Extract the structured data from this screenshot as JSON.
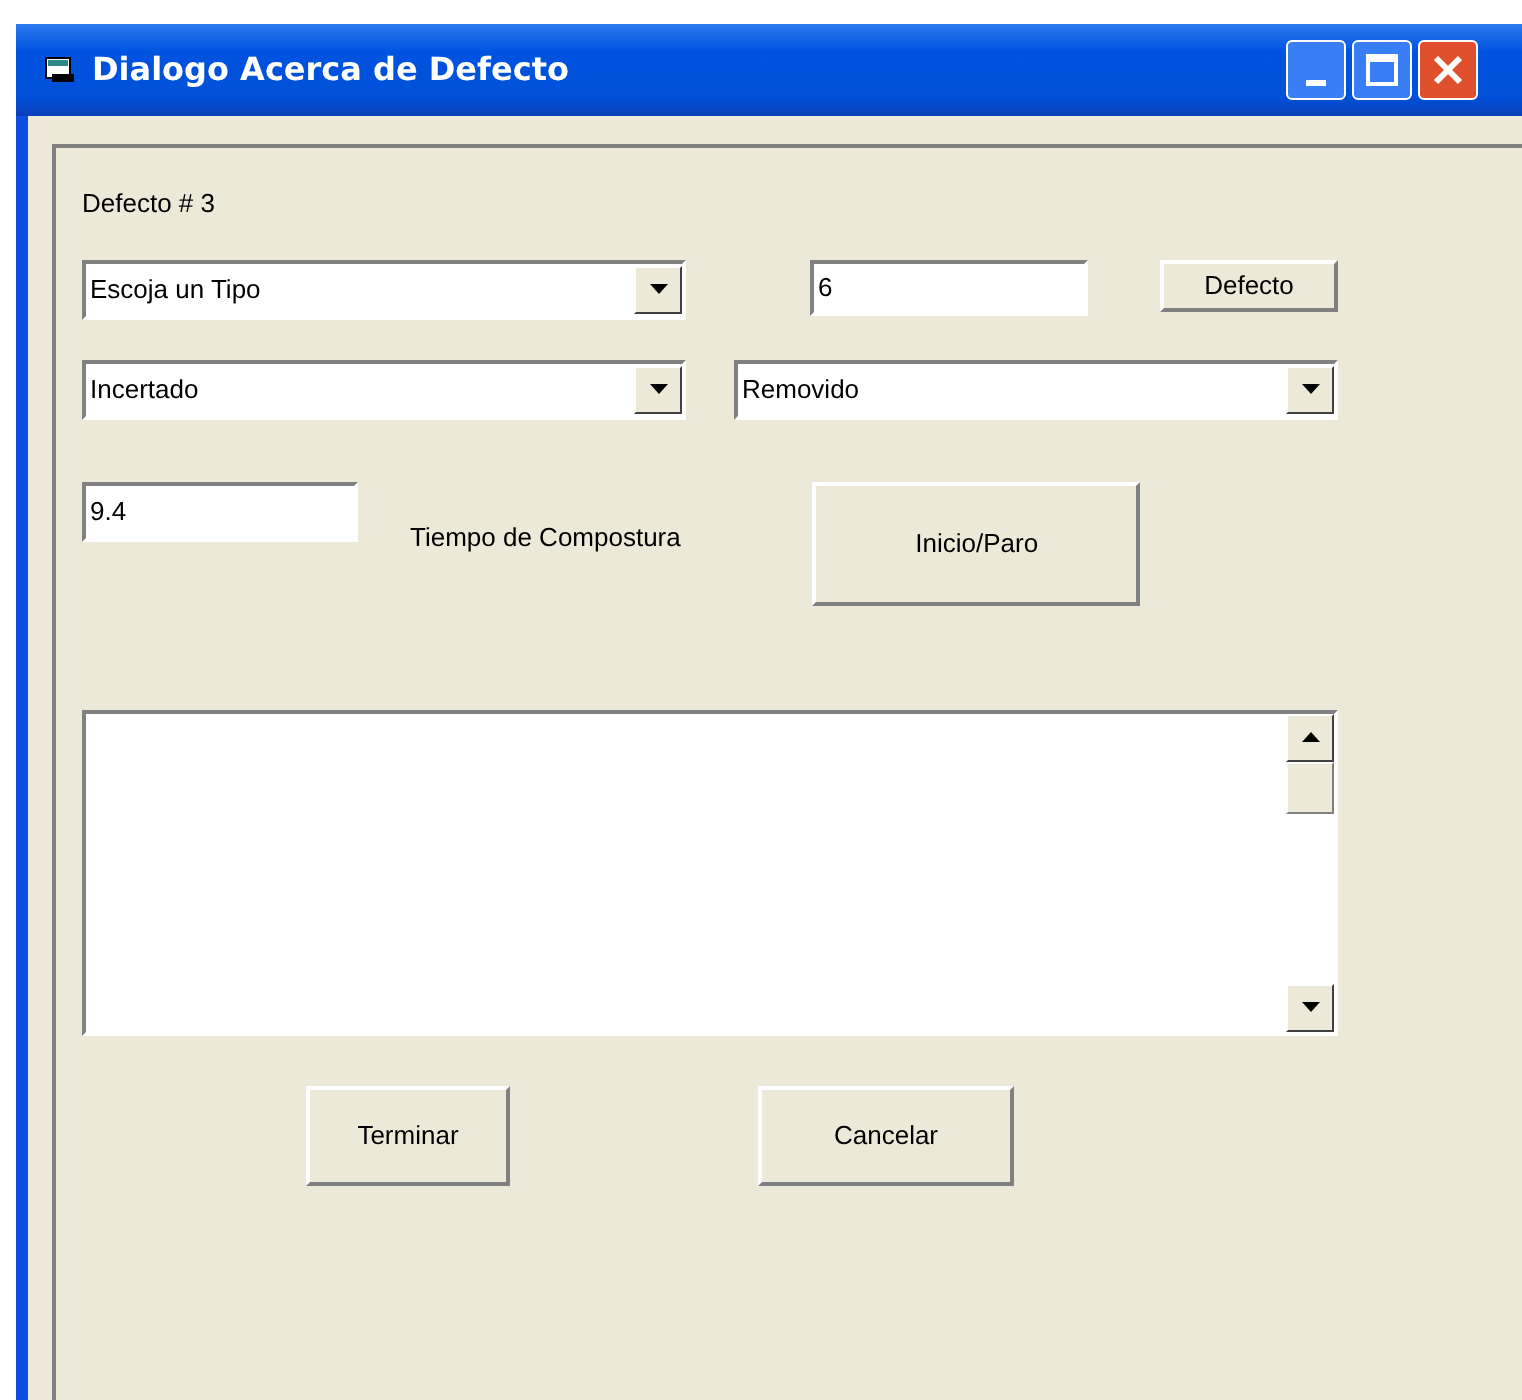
{
  "window": {
    "title": "Dialogo Acerca de Defecto"
  },
  "defect_label": "Defecto # 3",
  "type_combo": {
    "value": "Escoja un Tipo"
  },
  "number_field": {
    "value": "6"
  },
  "defect_button": "Defecto",
  "inserted_combo": {
    "value": "Incertado"
  },
  "removed_combo": {
    "value": "Removido"
  },
  "time_field": {
    "value": "9.4"
  },
  "time_label": "Tiempo de Compostura",
  "start_stop_button": "Inicio/Paro",
  "finish_button": "Terminar",
  "cancel_button": "Cancelar"
}
